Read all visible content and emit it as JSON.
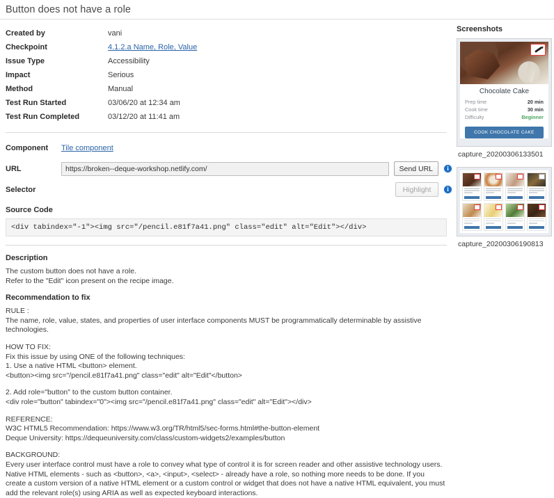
{
  "page_title": "Button does not have a role",
  "meta": {
    "rows": [
      {
        "label": "Created by",
        "value": "vani",
        "link": false
      },
      {
        "label": "Checkpoint",
        "value": "4.1.2.a Name, Role, Value",
        "link": true
      },
      {
        "label": "Issue Type",
        "value": "Accessibility",
        "link": false
      },
      {
        "label": "Impact",
        "value": "Serious",
        "link": false
      },
      {
        "label": "Method",
        "value": "Manual",
        "link": false
      },
      {
        "label": "Test Run Started",
        "value": "03/06/20 at 12:34 am",
        "link": false
      },
      {
        "label": "Test Run Completed",
        "value": "03/12/20 at 11:41 am",
        "link": false
      }
    ]
  },
  "form": {
    "component_label": "Component",
    "component_value": "Tile component",
    "url_label": "URL",
    "url_value": "https://broken--deque-workshop.netlify.com/",
    "url_placeholder": "https://",
    "send_url_label": "Send URL",
    "selector_label": "Selector",
    "selector_value": "",
    "selector_placeholder": "",
    "highlight_label": "Highlight",
    "info_icon": "info-icon",
    "source_code_label": "Source Code",
    "source_code_value": "<div tabindex=\"-1\"><img src=\"/pencil.e81f7a41.png\" class=\"edit\" alt=\"Edit\"></div>"
  },
  "description": {
    "heading": "Description",
    "text": "The custom button does not have a role.\nRefer to the \"Edit\" icon present on the recipe image.",
    "recommendation_heading": "Recommendation to fix",
    "rule_block": "RULE :\nThe name, role, value, states, and properties of user interface components MUST be programmatically determinable by assistive technologies.",
    "howtofix_block": "HOW TO FIX:\nFix this issue by using ONE of the following techniques:\n1. Use a native HTML <button> element.\n<button><img src=\"/pencil.e81f7a41.png\" class=\"edit\" alt=\"Edit\"</button>",
    "howtofix_block2": "2. Add role=\"button\" to the custom button container.\n<div role=\"button\" tabindex=\"0\"><img src=\"/pencil.e81f7a41.png\" class=\"edit\" alt=\"Edit\"></div>",
    "reference_block": "REFERENCE:\nW3C HTML5 Recommendation: https://www.w3.org/TR/html5/sec-forms.html#the-button-element\nDeque University: https://dequeuniversity.com/class/custom-widgets2/examples/button",
    "background_block": "BACKGROUND:\nEvery user interface control must have a role to convey what type of control it is for screen reader and other assistive technology users. Native HTML elements - such as <button>, <a>, <input>, <select> - already have a role, so nothing more needs to be done. If you create a custom version of a native HTML element or a custom control or widget that does not have a native HTML equivalent, you must add the relevant role(s) using ARIA as well as expected keyboard interactions."
  },
  "screenshots": {
    "heading": "Screenshots",
    "items": [
      {
        "caption": "capture_20200306133501",
        "type": "recipe-card"
      },
      {
        "caption": "capture_20200306190813",
        "type": "recipe-grid"
      }
    ],
    "recipe_card": {
      "title": "Chocolate Cake",
      "rows": [
        {
          "label": "Prep time",
          "value": "20 min",
          "accent": false
        },
        {
          "label": "Cook time",
          "value": "30 min",
          "accent": false
        },
        {
          "label": "Difficulty",
          "value": "Beginner",
          "accent": true
        }
      ],
      "cta": "COOK CHOCOLATE CAKE",
      "edit_icon": "pencil-edit-icon"
    }
  },
  "colors": {
    "link": "#2a63a8",
    "accent_blue": "#3f76ab",
    "highlight_red": "#e23b3b",
    "difficulty_green": "#4aa45e"
  }
}
